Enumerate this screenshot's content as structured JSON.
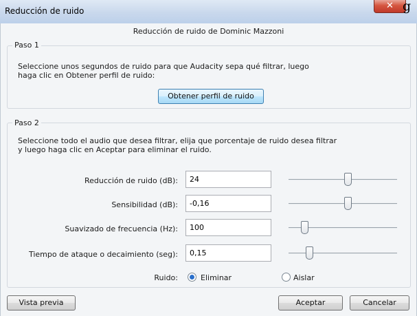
{
  "window": {
    "title": "Reducción de ruido",
    "close_glyph": "✕",
    "stray_text": "g"
  },
  "heading": "Reducción de ruido de Dominic Mazzoni",
  "step1": {
    "legend": "Paso 1",
    "description_line1": "Seleccione unos segundos de ruido para que Audacity sepa qué filtrar, luego",
    "description_line2": "haga clic en Obtener perfil de ruido:",
    "button_label": "Obtener perfil de ruido"
  },
  "step2": {
    "legend": "Paso 2",
    "description_line1": "Seleccione todo el audio que desea filtrar, elija que porcentaje de ruido desea filtrar",
    "description_line2": "y luego haga clic en Aceptar para eliminar el ruido.",
    "params": [
      {
        "label": "Reducción de ruido (dB):",
        "value": "24",
        "slider_level": 0.55
      },
      {
        "label": "Sensibilidad (dB):",
        "value": "-0,16",
        "slider_level": 0.55
      },
      {
        "label": "Suavizado de frecuencia (Hz):",
        "value": "100",
        "slider_level": 0.12
      },
      {
        "label": "Tiempo de ataque o decaimiento (seg):",
        "value": "0,15",
        "slider_level": 0.17
      }
    ],
    "noise_label": "Ruido:",
    "noise_options": [
      {
        "label": "Eliminar",
        "selected": true
      },
      {
        "label": "Aislar",
        "selected": false
      }
    ]
  },
  "footer": {
    "preview_label": "Vista previa",
    "ok_label": "Aceptar",
    "cancel_label": "Cancelar"
  },
  "icons": {
    "close": "close-icon",
    "thumb": "slider-thumb"
  }
}
